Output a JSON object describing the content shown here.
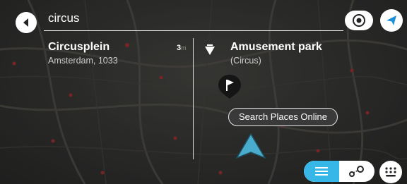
{
  "search": {
    "query": "circus"
  },
  "results": {
    "left": {
      "title": "Circusplein",
      "subtitle": "Amsterdam, 1033",
      "distance": "3",
      "distance_unit": "m"
    },
    "right": {
      "title": "Amusement park",
      "subtitle": "(Circus)"
    }
  },
  "buttons": {
    "search_places_online": "Search Places Online"
  },
  "icons": {
    "back": "back-arrow-icon",
    "visibility": "eye-icon",
    "navigate": "navigation-arrow-icon",
    "poi": "amusement-park-icon",
    "flag": "flag-pin-icon",
    "vehicle": "chevron-vehicle-icon",
    "list": "list-icon",
    "route": "route-icon",
    "keyboard": "keyboard-icon"
  },
  "colors": {
    "accent": "#37b7e8",
    "nav_blue": "#1b8fd8",
    "marker_red": "#b83333",
    "chevron_blue": "#4aaccc"
  }
}
